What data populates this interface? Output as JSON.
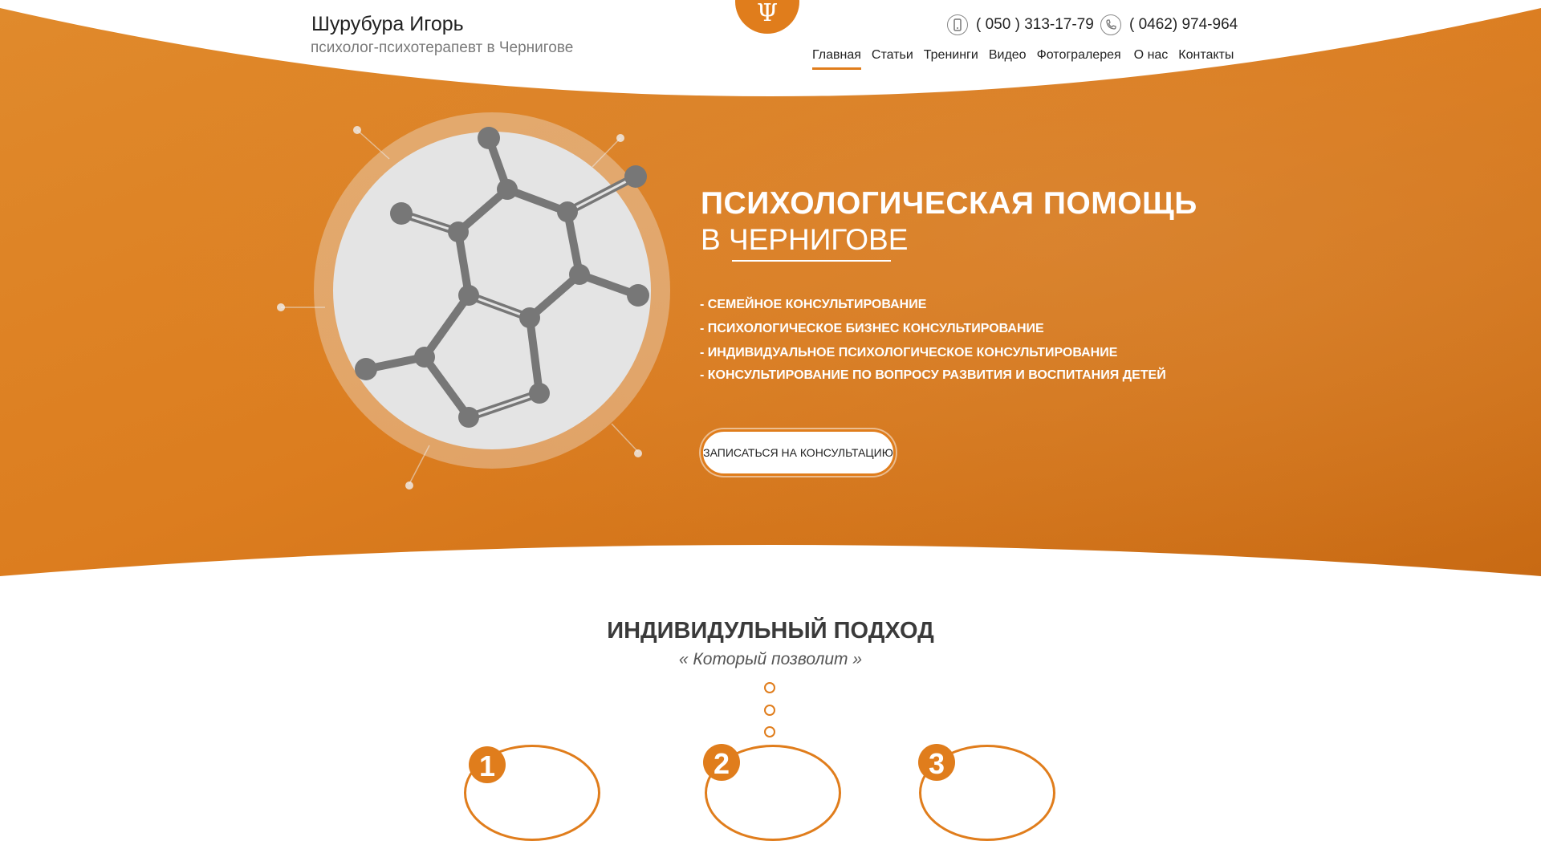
{
  "header": {
    "name": "Шурубура Игорь",
    "subtitle": "психолог-психотерапевт в Чернигове",
    "logo_symbol": "Ψ",
    "phones": [
      {
        "icon": "mobile-phone-icon",
        "number": "( 050 ) 313-17-79"
      },
      {
        "icon": "phone-handset-icon",
        "number": "( 0462) 974-964"
      }
    ],
    "nav": [
      {
        "label": "Главная",
        "active": true
      },
      {
        "label": "Статьи",
        "active": false
      },
      {
        "label": "Тренинги",
        "active": false
      },
      {
        "label": "Видео",
        "active": false
      },
      {
        "label": "Фотогралерея",
        "active": false
      },
      {
        "label": "О нас",
        "active": false
      },
      {
        "label": "Контакты",
        "active": false
      }
    ]
  },
  "hero": {
    "title_line1": "ПСИХОЛОГИЧЕСКАЯ ПОМОЩЬ",
    "title_line2": "В ЧЕРНИГОВЕ",
    "services": [
      "- СЕМЕЙНОЕ КОНСУЛЬТИРОВАНИЕ",
      "- ПСИХОЛОГИЧЕСКОЕ БИЗНЕС КОНСУЛЬТИРОВАНИЕ",
      "- ИНДИВИДУАЛЬНОЕ ПСИХОЛОГИЧЕСКОЕ КОНСУЛЬТИРОВАНИЕ",
      "- КОНСУЛЬТИРОВАНИЕ ПО ВОПРОСУ РАЗВИТИЯ И ВОСПИТАНИЯ ДЕТЕЙ"
    ],
    "cta": "ЗАПИСАТЬСЯ НА КОНСУЛЬТАЦИЮ"
  },
  "section": {
    "title": "ИНДИВИДУЛЬНЫЙ ПОДХОД",
    "subtitle": "« Который  позволит »",
    "steps": [
      "1",
      "2",
      "3"
    ]
  },
  "colors": {
    "accent": "#e07d1c",
    "text_dark": "#222222",
    "molecule": "#777777"
  }
}
